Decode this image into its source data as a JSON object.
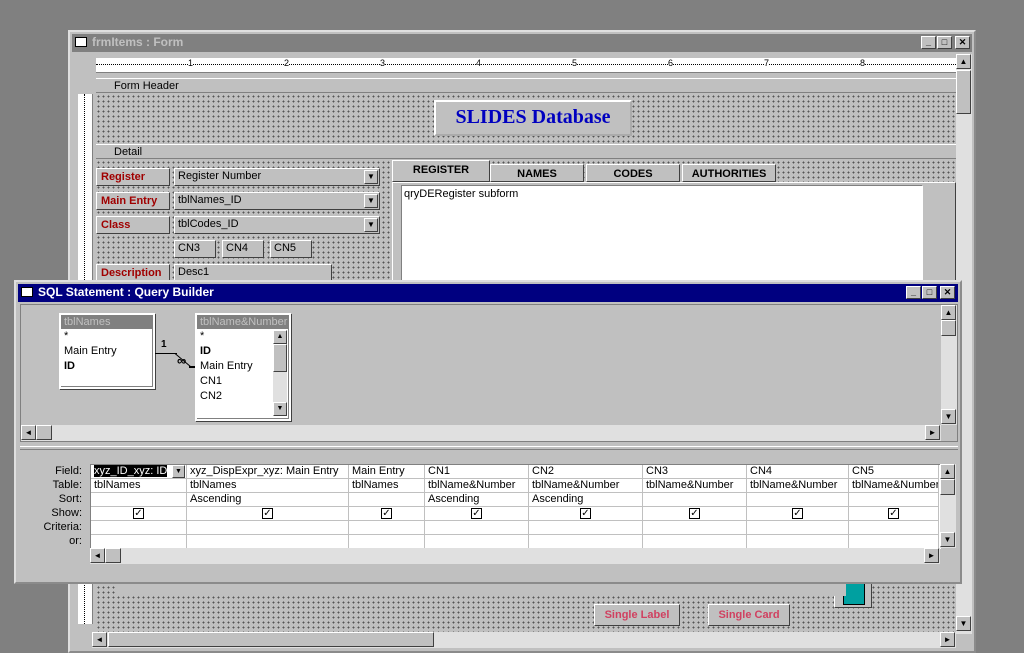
{
  "form_window": {
    "title": "frmItems : Form",
    "ruler_marks": [
      "1",
      "2",
      "3",
      "4",
      "5",
      "6",
      "7",
      "8"
    ],
    "sections": {
      "header": "Form Header",
      "detail": "Detail"
    },
    "header_title": "SLIDES Database",
    "labels": {
      "register": "Register",
      "main_entry": "Main Entry",
      "class": "Class",
      "description": "Description"
    },
    "fields": {
      "register": "Register Number",
      "main_entry": "tblNames_ID",
      "class": "tblCodes_ID",
      "desc": "Desc1"
    },
    "cn_fields": [
      "CN3",
      "CN4",
      "CN5"
    ],
    "tabs": [
      "REGISTER",
      "NAMES",
      "CODES",
      "AUTHORITIES"
    ],
    "subform_label": "qryDERegister subform",
    "bottom_buttons": {
      "single_label": "Single Label",
      "single_card": "Single Card"
    }
  },
  "query_window": {
    "title": "SQL Statement : Query Builder",
    "table1": {
      "name": "tblNames",
      "fields": [
        "*",
        "Main Entry",
        "ID"
      ]
    },
    "table2": {
      "name": "tblName&Number",
      "fields": [
        "*",
        "ID",
        "Main Entry",
        "CN1",
        "CN2"
      ]
    },
    "join": {
      "left": "1",
      "right": "∞"
    },
    "row_labels": [
      "Field:",
      "Table:",
      "Sort:",
      "Show:",
      "Criteria:",
      "or:"
    ],
    "columns": [
      {
        "field": "xyz_ID_xyz: ID",
        "table": "tblNames",
        "sort": "",
        "show": true
      },
      {
        "field": "xyz_DispExpr_xyz: Main Entry",
        "table": "tblNames",
        "sort": "Ascending",
        "show": true
      },
      {
        "field": "Main Entry",
        "table": "tblNames",
        "sort": "",
        "show": true
      },
      {
        "field": "CN1",
        "table": "tblName&Number",
        "sort": "Ascending",
        "show": true
      },
      {
        "field": "CN2",
        "table": "tblName&Number",
        "sort": "Ascending",
        "show": true
      },
      {
        "field": "CN3",
        "table": "tblName&Number",
        "sort": "",
        "show": true
      },
      {
        "field": "CN4",
        "table": "tblName&Number",
        "sort": "",
        "show": true
      },
      {
        "field": "CN5",
        "table": "tblName&Number",
        "sort": "",
        "show": true
      }
    ]
  },
  "icons": {
    "check": "✓",
    "up": "▲",
    "down": "▼",
    "left": "◄",
    "right": "►",
    "min": "_",
    "max": "□",
    "close": "✕"
  }
}
